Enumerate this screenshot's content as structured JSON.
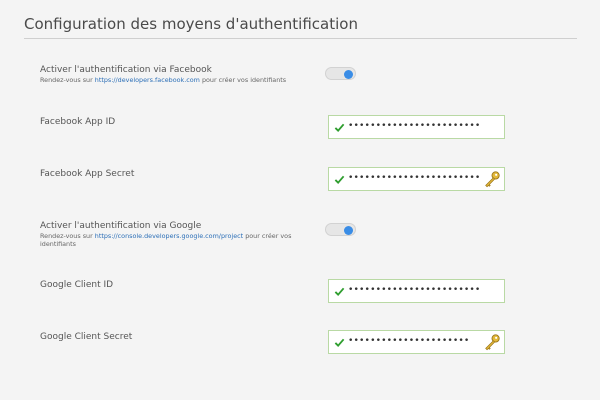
{
  "header": {
    "title": "Configuration des moyens d'authentification"
  },
  "facebook_auth": {
    "label": "Activer l'authentification via Facebook",
    "hint_prefix": "Rendez-vous sur ",
    "hint_link": "https://developers.facebook.com",
    "hint_suffix": " pour créer vos identifiants",
    "enabled": true
  },
  "facebook_app_id": {
    "label": "Facebook App ID",
    "value": "••••••••••••••••••••••••"
  },
  "facebook_app_secret": {
    "label": "Facebook App Secret",
    "value": "••••••••••••••••••••••••"
  },
  "google_auth": {
    "label": "Activer l'authentification via Google",
    "hint_prefix": "Rendez-vous sur ",
    "hint_link": "https://console.developers.google.com/project",
    "hint_suffix": " pour créer vos identifiants",
    "enabled": true
  },
  "google_client_id": {
    "label": "Google Client ID",
    "value": "••••••••••••••••••••••••"
  },
  "google_client_secret": {
    "label": "Google Client Secret",
    "value": "••••••••••••••••••••••"
  },
  "colors": {
    "accent": "#3a8de6",
    "valid": "#2f9e2f",
    "link": "#2c6fb7"
  }
}
